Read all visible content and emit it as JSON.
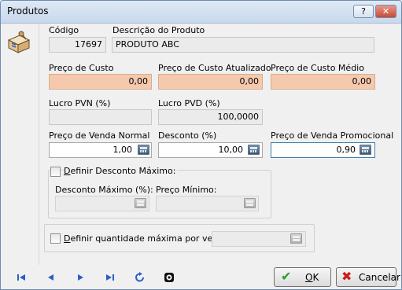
{
  "window": {
    "title": "Produtos",
    "help_label": "?",
    "close_label": "✕"
  },
  "product": {
    "code_label": "Código",
    "code_value": "17697",
    "desc_label": "Descrição do Produto",
    "desc_value": "PRODUTO ABC"
  },
  "costs": {
    "cost_label": "Preço de Custo",
    "cost_value": "0,00",
    "updated_label": "Preço de Custo Atualizado",
    "updated_value": "0,00",
    "avg_label": "Preço de Custo Médio",
    "avg_value": "0,00"
  },
  "profit": {
    "pvn_label": "Lucro PVN (%)",
    "pvn_value": "",
    "pvd_label": "Lucro PVD (%)",
    "pvd_value": "100,0000"
  },
  "sale": {
    "normal_label": "Preço de Venda Normal",
    "normal_value": "1,00",
    "discount_label": "Desconto (%)",
    "discount_value": "10,00",
    "promo_label": "Preço de Venda Promocional",
    "promo_value": "0,90"
  },
  "max_discount": {
    "checkbox_prefix": "",
    "checkbox_underlined": "D",
    "checkbox_rest": "efinir Desconto Máximo:",
    "max_label": "Desconto Máximo (%):",
    "max_value": "",
    "min_label": "Preço Mínimo:",
    "min_value": ""
  },
  "max_qty": {
    "checkbox_underlined": "D",
    "checkbox_rest": "efinir quantidade máxima por venda:",
    "value": ""
  },
  "buttons": {
    "ok_underlined": "O",
    "ok_rest": "K",
    "cancel_label": "Cancelar"
  },
  "icons": {
    "first": "first-record-icon",
    "prev": "prev-record-icon",
    "next": "next-record-icon",
    "last": "last-record-icon",
    "refresh": "refresh-icon",
    "target": "record-target-icon"
  },
  "colors": {
    "cost_bg": "#f5c9ad",
    "nav_blue": "#2a5ec8",
    "ok_green": "#2e9a2e",
    "cancel_red": "#c81e1e"
  }
}
